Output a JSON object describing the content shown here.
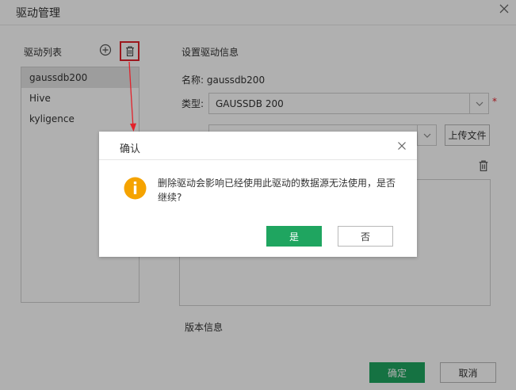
{
  "window": {
    "title": "驱动管理"
  },
  "left_panel": {
    "label": "驱动列表",
    "items": [
      {
        "label": "gaussdb200",
        "selected": true
      },
      {
        "label": "Hive",
        "selected": false
      },
      {
        "label": "kyligence",
        "selected": false
      }
    ]
  },
  "right_panel": {
    "title": "设置驱动信息",
    "name_text": "名称: gaussdb200",
    "type_label": "类型:",
    "type_value": "GAUSSDB 200",
    "required_mark": "*",
    "upload_label": "上传文件",
    "version_label": "版本信息"
  },
  "footer": {
    "ok_label": "确定",
    "cancel_label": "取消"
  },
  "dialog": {
    "title": "确认",
    "message": "删除驱动会影响已经使用此驱动的数据源无法使用，是否继续?",
    "yes_label": "是",
    "no_label": "否"
  },
  "colors": {
    "accent_green": "#1fa560",
    "highlight_red": "#e2222b",
    "warning_orange": "#f5a300",
    "selected_row": "#e4e4e4"
  },
  "icons": [
    "close-icon",
    "add-circle-icon",
    "trash-icon",
    "chevron-down-icon",
    "warning-info-icon"
  ]
}
